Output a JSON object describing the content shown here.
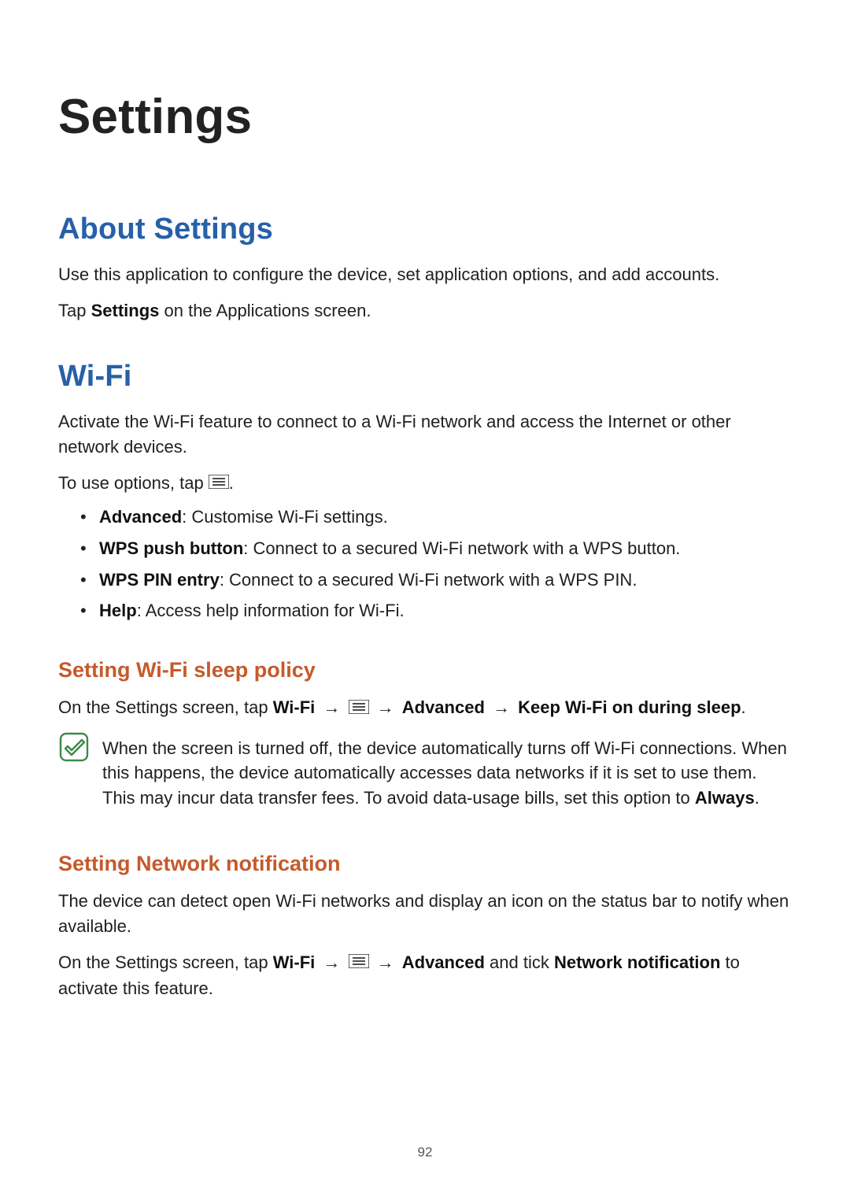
{
  "page": {
    "title": "Settings",
    "number": "92"
  },
  "about": {
    "heading": "About Settings",
    "p1": "Use this application to configure the device, set application options, and add accounts.",
    "p2_pre": "Tap ",
    "p2_bold": "Settings",
    "p2_post": " on the Applications screen."
  },
  "wifi": {
    "heading": "Wi-Fi",
    "intro": "Activate the Wi-Fi feature to connect to a Wi-Fi network and access the Internet or other network devices.",
    "options_lead": "To use options, tap ",
    "options_tail": ".",
    "items": [
      {
        "label": "Advanced",
        "desc": ": Customise Wi-Fi settings."
      },
      {
        "label": "WPS push button",
        "desc": ": Connect to a secured Wi-Fi network with a WPS button."
      },
      {
        "label": "WPS PIN entry",
        "desc": ": Connect to a secured Wi-Fi network with a WPS PIN."
      },
      {
        "label": "Help",
        "desc": ": Access help information for Wi-Fi."
      }
    ],
    "sleep": {
      "heading": "Setting Wi-Fi sleep policy",
      "line_pre": "On the Settings screen, tap ",
      "wifi_bold": "Wi-Fi",
      "arrow": " → ",
      "advanced_bold": "Advanced",
      "keep_bold": "Keep Wi-Fi on during sleep",
      "line_end": ".",
      "note_pre": "When the screen is turned off, the device automatically turns off Wi-Fi connections. When this happens, the device automatically accesses data networks if it is set to use them. This may incur data transfer fees. To avoid data-usage bills, set this option to ",
      "note_bold": "Always",
      "note_post": "."
    },
    "netnotif": {
      "heading": "Setting Network notification",
      "p1": "The device can detect open Wi-Fi networks and display an icon on the status bar to notify when available.",
      "line_pre": "On the Settings screen, tap ",
      "wifi_bold": "Wi-Fi",
      "arrow": " → ",
      "advanced_bold": "Advanced",
      "mid": " and tick ",
      "netnotif_bold": "Network notification",
      "line_post": " to activate this feature."
    }
  },
  "icons": {
    "menu": "menu-icon",
    "note": "note-icon"
  }
}
